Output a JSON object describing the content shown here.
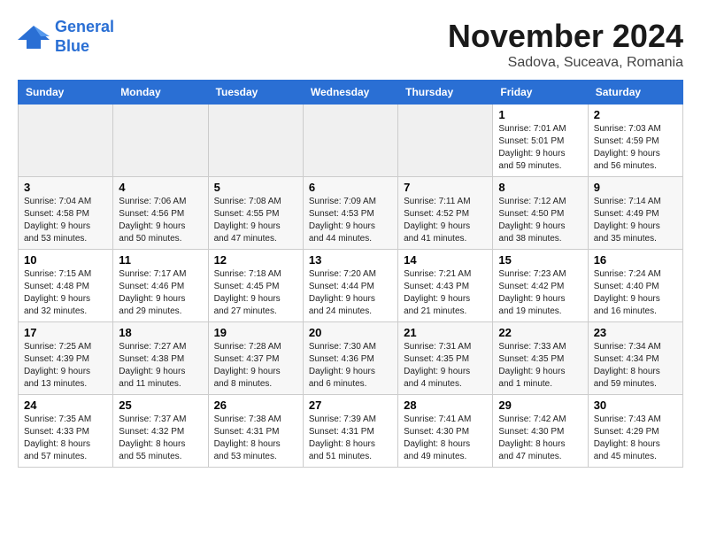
{
  "logo": {
    "line1": "General",
    "line2": "Blue"
  },
  "title": "November 2024",
  "location": "Sadova, Suceava, Romania",
  "weekdays": [
    "Sunday",
    "Monday",
    "Tuesday",
    "Wednesday",
    "Thursday",
    "Friday",
    "Saturday"
  ],
  "weeks": [
    [
      {
        "day": "",
        "info": ""
      },
      {
        "day": "",
        "info": ""
      },
      {
        "day": "",
        "info": ""
      },
      {
        "day": "",
        "info": ""
      },
      {
        "day": "",
        "info": ""
      },
      {
        "day": "1",
        "info": "Sunrise: 7:01 AM\nSunset: 5:01 PM\nDaylight: 9 hours and 59 minutes."
      },
      {
        "day": "2",
        "info": "Sunrise: 7:03 AM\nSunset: 4:59 PM\nDaylight: 9 hours and 56 minutes."
      }
    ],
    [
      {
        "day": "3",
        "info": "Sunrise: 7:04 AM\nSunset: 4:58 PM\nDaylight: 9 hours and 53 minutes."
      },
      {
        "day": "4",
        "info": "Sunrise: 7:06 AM\nSunset: 4:56 PM\nDaylight: 9 hours and 50 minutes."
      },
      {
        "day": "5",
        "info": "Sunrise: 7:08 AM\nSunset: 4:55 PM\nDaylight: 9 hours and 47 minutes."
      },
      {
        "day": "6",
        "info": "Sunrise: 7:09 AM\nSunset: 4:53 PM\nDaylight: 9 hours and 44 minutes."
      },
      {
        "day": "7",
        "info": "Sunrise: 7:11 AM\nSunset: 4:52 PM\nDaylight: 9 hours and 41 minutes."
      },
      {
        "day": "8",
        "info": "Sunrise: 7:12 AM\nSunset: 4:50 PM\nDaylight: 9 hours and 38 minutes."
      },
      {
        "day": "9",
        "info": "Sunrise: 7:14 AM\nSunset: 4:49 PM\nDaylight: 9 hours and 35 minutes."
      }
    ],
    [
      {
        "day": "10",
        "info": "Sunrise: 7:15 AM\nSunset: 4:48 PM\nDaylight: 9 hours and 32 minutes."
      },
      {
        "day": "11",
        "info": "Sunrise: 7:17 AM\nSunset: 4:46 PM\nDaylight: 9 hours and 29 minutes."
      },
      {
        "day": "12",
        "info": "Sunrise: 7:18 AM\nSunset: 4:45 PM\nDaylight: 9 hours and 27 minutes."
      },
      {
        "day": "13",
        "info": "Sunrise: 7:20 AM\nSunset: 4:44 PM\nDaylight: 9 hours and 24 minutes."
      },
      {
        "day": "14",
        "info": "Sunrise: 7:21 AM\nSunset: 4:43 PM\nDaylight: 9 hours and 21 minutes."
      },
      {
        "day": "15",
        "info": "Sunrise: 7:23 AM\nSunset: 4:42 PM\nDaylight: 9 hours and 19 minutes."
      },
      {
        "day": "16",
        "info": "Sunrise: 7:24 AM\nSunset: 4:40 PM\nDaylight: 9 hours and 16 minutes."
      }
    ],
    [
      {
        "day": "17",
        "info": "Sunrise: 7:25 AM\nSunset: 4:39 PM\nDaylight: 9 hours and 13 minutes."
      },
      {
        "day": "18",
        "info": "Sunrise: 7:27 AM\nSunset: 4:38 PM\nDaylight: 9 hours and 11 minutes."
      },
      {
        "day": "19",
        "info": "Sunrise: 7:28 AM\nSunset: 4:37 PM\nDaylight: 9 hours and 8 minutes."
      },
      {
        "day": "20",
        "info": "Sunrise: 7:30 AM\nSunset: 4:36 PM\nDaylight: 9 hours and 6 minutes."
      },
      {
        "day": "21",
        "info": "Sunrise: 7:31 AM\nSunset: 4:35 PM\nDaylight: 9 hours and 4 minutes."
      },
      {
        "day": "22",
        "info": "Sunrise: 7:33 AM\nSunset: 4:35 PM\nDaylight: 9 hours and 1 minute."
      },
      {
        "day": "23",
        "info": "Sunrise: 7:34 AM\nSunset: 4:34 PM\nDaylight: 8 hours and 59 minutes."
      }
    ],
    [
      {
        "day": "24",
        "info": "Sunrise: 7:35 AM\nSunset: 4:33 PM\nDaylight: 8 hours and 57 minutes."
      },
      {
        "day": "25",
        "info": "Sunrise: 7:37 AM\nSunset: 4:32 PM\nDaylight: 8 hours and 55 minutes."
      },
      {
        "day": "26",
        "info": "Sunrise: 7:38 AM\nSunset: 4:31 PM\nDaylight: 8 hours and 53 minutes."
      },
      {
        "day": "27",
        "info": "Sunrise: 7:39 AM\nSunset: 4:31 PM\nDaylight: 8 hours and 51 minutes."
      },
      {
        "day": "28",
        "info": "Sunrise: 7:41 AM\nSunset: 4:30 PM\nDaylight: 8 hours and 49 minutes."
      },
      {
        "day": "29",
        "info": "Sunrise: 7:42 AM\nSunset: 4:30 PM\nDaylight: 8 hours and 47 minutes."
      },
      {
        "day": "30",
        "info": "Sunrise: 7:43 AM\nSunset: 4:29 PM\nDaylight: 8 hours and 45 minutes."
      }
    ]
  ]
}
